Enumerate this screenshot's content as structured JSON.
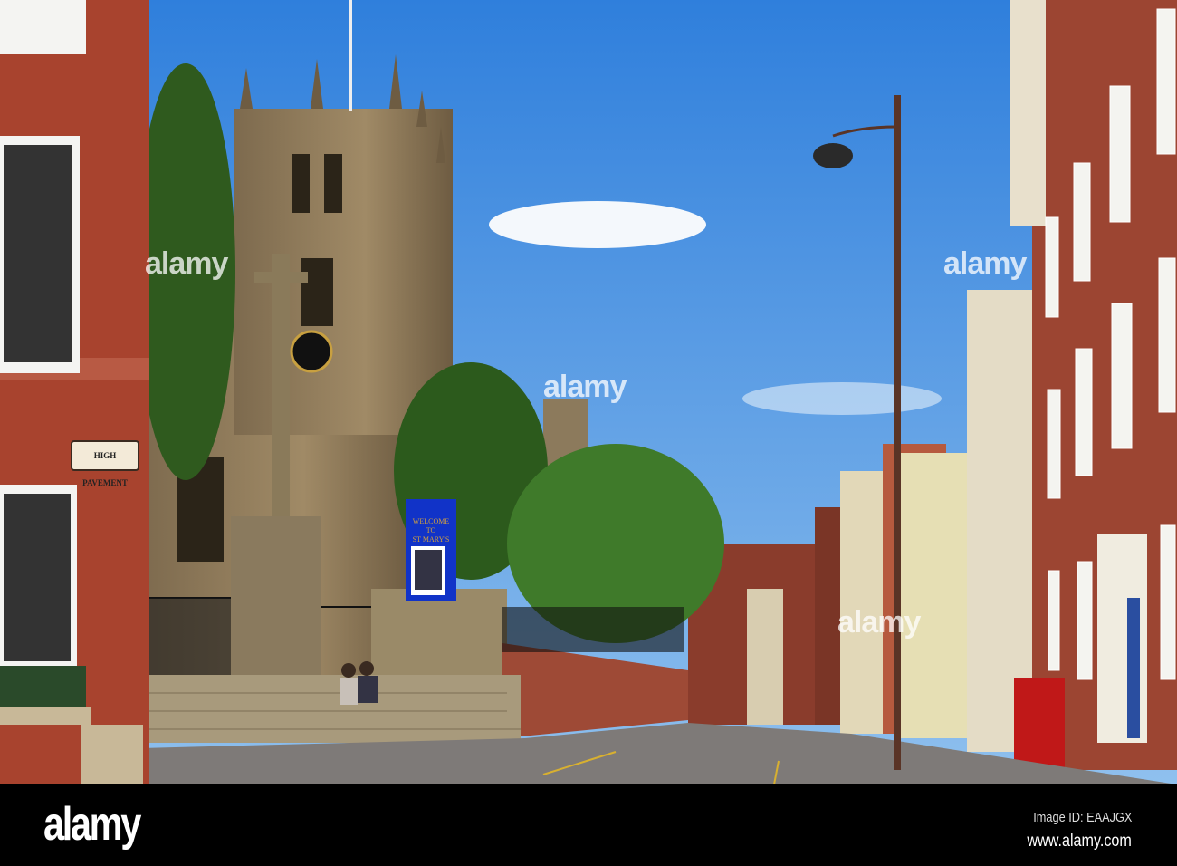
{
  "scene": {
    "street_sign": "HIGH PAVEMENT",
    "church_board": {
      "line1": "WELCOME",
      "line2": "TO",
      "line3": "ST MARY'S"
    },
    "watermark": "alamy"
  },
  "footer": {
    "logo": "alamy",
    "image_id": "Image ID: EAAJGX",
    "website": "www.alamy.com"
  },
  "colors": {
    "sky": "#3f8ee0",
    "brick": "#a8432e",
    "stone": "#8c7a5c",
    "footer": "#000000"
  }
}
